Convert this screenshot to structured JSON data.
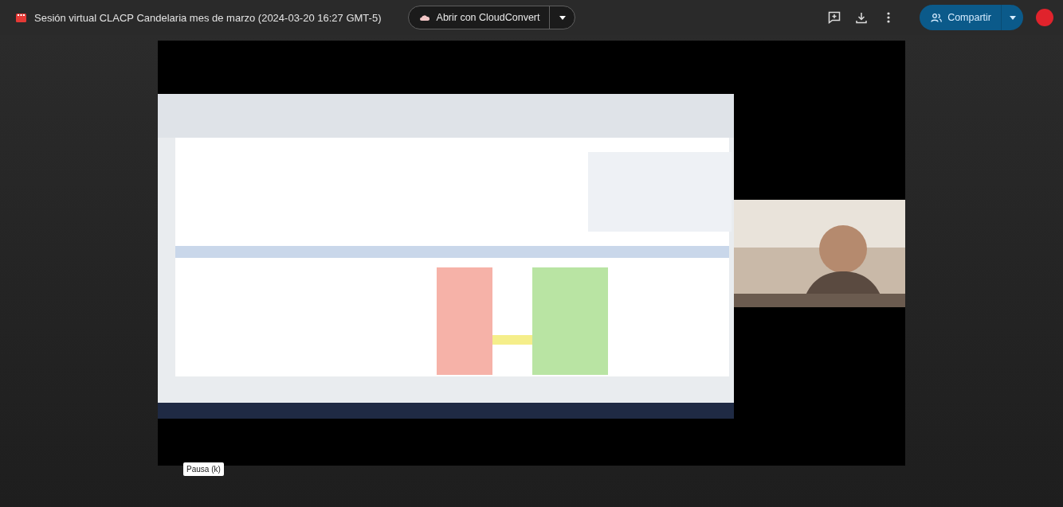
{
  "file": {
    "title": "Sesión virtual CLACP Candelaria mes de marzo (2024-03-20 16:27 GMT-5)"
  },
  "open_with": {
    "label": "Abrir con CloudConvert"
  },
  "share_button": {
    "label": "Compartir"
  },
  "video": {
    "kind": "picture",
    "tooltip": "Pausa (k)"
  }
}
